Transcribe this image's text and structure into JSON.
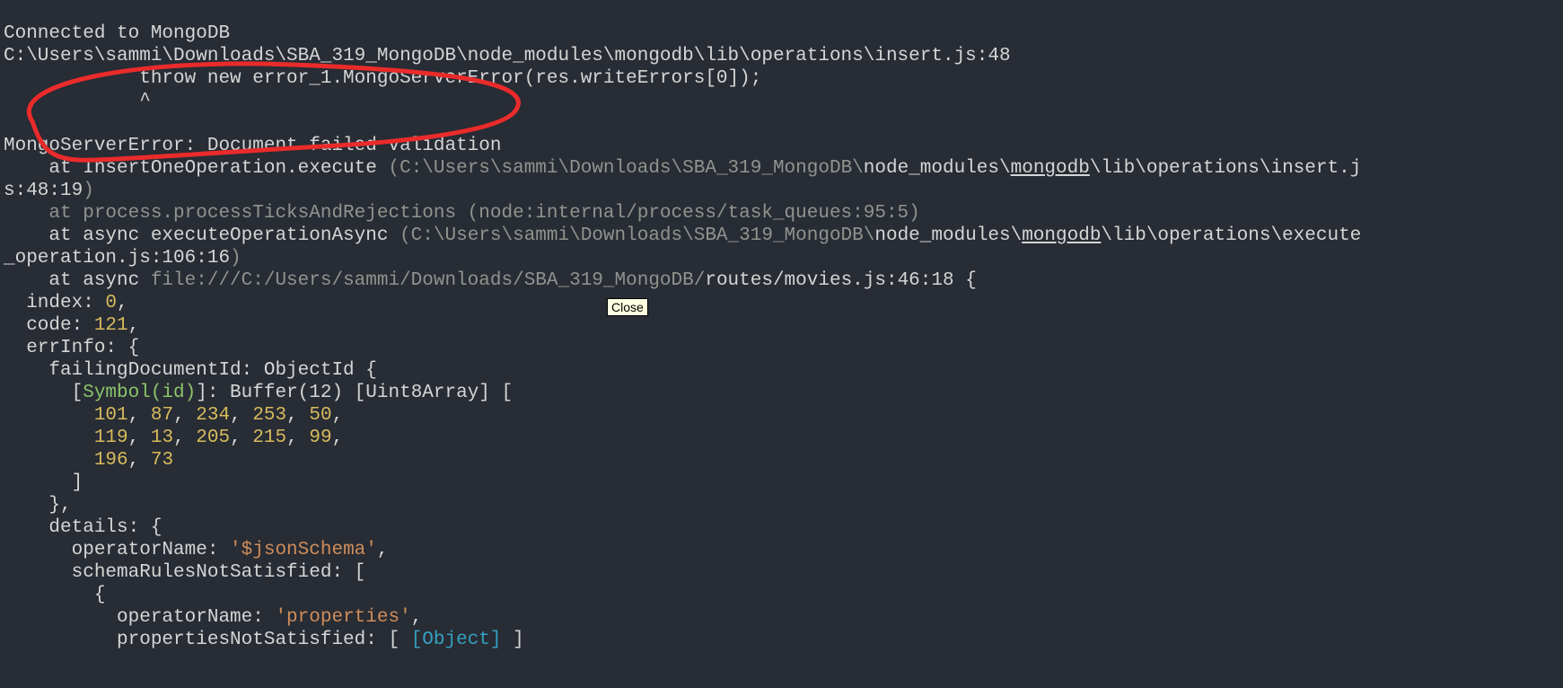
{
  "terminal": {
    "line0": "Connected to MongoDB",
    "line1": "C:\\Users\\sammi\\Downloads\\SBA_319_MongoDB\\node_modules\\mongodb\\lib\\operations\\insert.js:48",
    "line2": "            throw new error_1.MongoServerError(res.writeErrors[0]);",
    "line3": "            ^",
    "blank1": "",
    "err_title": "MongoServerError: Document failed validation",
    "at1_pre": "    at InsertOneOperation.execute ",
    "at1_gray_a": "(C:\\Users\\sammi\\Downloads\\SBA_319_MongoDB\\",
    "at1_white_a": "node_modules\\",
    "at1_link": "mongodb",
    "at1_white_b": "\\lib\\operations\\insert.j",
    "at1_cont": "s:48:19",
    "at1_close": ")",
    "at2": "    at process.processTicksAndRejections (node:internal/process/task_queues:95:5)",
    "at3_pre": "    at async executeOperationAsync ",
    "at3_gray_a": "(C:\\Users\\sammi\\Downloads\\SBA_319_MongoDB\\",
    "at3_white_a": "node_modules\\",
    "at3_link": "mongodb",
    "at3_white_b": "\\lib\\operations\\execute",
    "at3_cont": "_operation.js:106:16",
    "at3_close": ")",
    "at4_pre": "    at async ",
    "at4_gray": "file:///C:/Users/sammi/Downloads/SBA_319_MongoDB/",
    "at4_white": "routes/movies.js:46:18 {",
    "idx_lbl": "  index: ",
    "idx_val": "0",
    "code_lbl": "  code: ",
    "code_val": "121",
    "errinfo": "  errInfo: {",
    "failId": "    failingDocumentId: ObjectId {",
    "sym_open": "      [",
    "sym_name": "Symbol(id)",
    "sym_rest": "]: Buffer(12) [Uint8Array] [",
    "buf1_pad": "        ",
    "b101": "101",
    "b87": "87",
    "b234": "234",
    "b253": "253",
    "b50": "50",
    "buf2_pad": "        ",
    "b119": "119",
    "b13": "13",
    "b205": "205",
    "b215": "215",
    "b99": "99",
    "buf3_pad": "        ",
    "b196": "196",
    "b73": "73",
    "buf_close": "      ]",
    "obj_close": "    },",
    "details": "    details: {",
    "op_lbl": "      operatorName: ",
    "op_val": "'$jsonSchema'",
    "schema_open": "      schemaRulesNotSatisfied: [",
    "brace_open": "        {",
    "op2_lbl": "          operatorName: ",
    "op2_val": "'properties'",
    "props_lbl": "          propertiesNotSatisfied: [ ",
    "props_obj": "[Object]",
    "props_end": " ]",
    "comma": ", ",
    "comma2": ","
  },
  "tooltip": {
    "label": "Close"
  }
}
